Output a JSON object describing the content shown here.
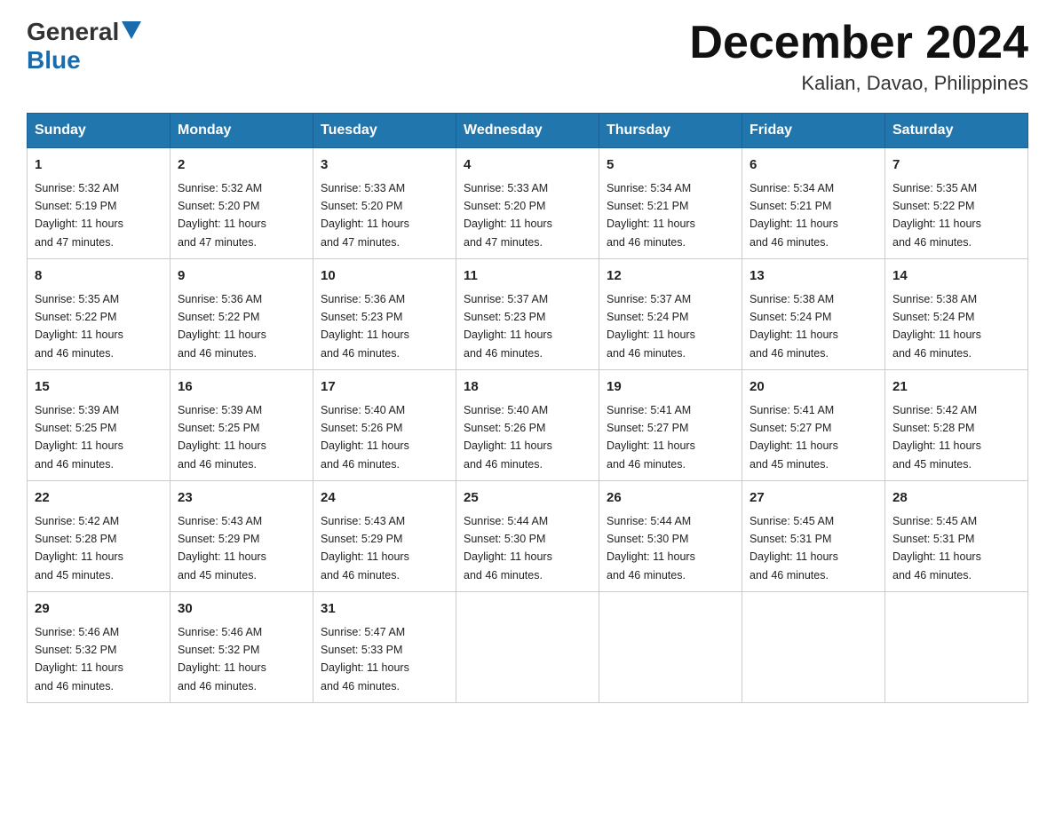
{
  "header": {
    "logo": {
      "general": "General",
      "blue": "Blue"
    },
    "month_year": "December 2024",
    "location": "Kalian, Davao, Philippines"
  },
  "weekdays": [
    "Sunday",
    "Monday",
    "Tuesday",
    "Wednesday",
    "Thursday",
    "Friday",
    "Saturday"
  ],
  "weeks": [
    [
      {
        "day": "1",
        "sunrise": "5:32 AM",
        "sunset": "5:19 PM",
        "daylight": "11 hours and 47 minutes."
      },
      {
        "day": "2",
        "sunrise": "5:32 AM",
        "sunset": "5:20 PM",
        "daylight": "11 hours and 47 minutes."
      },
      {
        "day": "3",
        "sunrise": "5:33 AM",
        "sunset": "5:20 PM",
        "daylight": "11 hours and 47 minutes."
      },
      {
        "day": "4",
        "sunrise": "5:33 AM",
        "sunset": "5:20 PM",
        "daylight": "11 hours and 47 minutes."
      },
      {
        "day": "5",
        "sunrise": "5:34 AM",
        "sunset": "5:21 PM",
        "daylight": "11 hours and 46 minutes."
      },
      {
        "day": "6",
        "sunrise": "5:34 AM",
        "sunset": "5:21 PM",
        "daylight": "11 hours and 46 minutes."
      },
      {
        "day": "7",
        "sunrise": "5:35 AM",
        "sunset": "5:22 PM",
        "daylight": "11 hours and 46 minutes."
      }
    ],
    [
      {
        "day": "8",
        "sunrise": "5:35 AM",
        "sunset": "5:22 PM",
        "daylight": "11 hours and 46 minutes."
      },
      {
        "day": "9",
        "sunrise": "5:36 AM",
        "sunset": "5:22 PM",
        "daylight": "11 hours and 46 minutes."
      },
      {
        "day": "10",
        "sunrise": "5:36 AM",
        "sunset": "5:23 PM",
        "daylight": "11 hours and 46 minutes."
      },
      {
        "day": "11",
        "sunrise": "5:37 AM",
        "sunset": "5:23 PM",
        "daylight": "11 hours and 46 minutes."
      },
      {
        "day": "12",
        "sunrise": "5:37 AM",
        "sunset": "5:24 PM",
        "daylight": "11 hours and 46 minutes."
      },
      {
        "day": "13",
        "sunrise": "5:38 AM",
        "sunset": "5:24 PM",
        "daylight": "11 hours and 46 minutes."
      },
      {
        "day": "14",
        "sunrise": "5:38 AM",
        "sunset": "5:24 PM",
        "daylight": "11 hours and 46 minutes."
      }
    ],
    [
      {
        "day": "15",
        "sunrise": "5:39 AM",
        "sunset": "5:25 PM",
        "daylight": "11 hours and 46 minutes."
      },
      {
        "day": "16",
        "sunrise": "5:39 AM",
        "sunset": "5:25 PM",
        "daylight": "11 hours and 46 minutes."
      },
      {
        "day": "17",
        "sunrise": "5:40 AM",
        "sunset": "5:26 PM",
        "daylight": "11 hours and 46 minutes."
      },
      {
        "day": "18",
        "sunrise": "5:40 AM",
        "sunset": "5:26 PM",
        "daylight": "11 hours and 46 minutes."
      },
      {
        "day": "19",
        "sunrise": "5:41 AM",
        "sunset": "5:27 PM",
        "daylight": "11 hours and 46 minutes."
      },
      {
        "day": "20",
        "sunrise": "5:41 AM",
        "sunset": "5:27 PM",
        "daylight": "11 hours and 45 minutes."
      },
      {
        "day": "21",
        "sunrise": "5:42 AM",
        "sunset": "5:28 PM",
        "daylight": "11 hours and 45 minutes."
      }
    ],
    [
      {
        "day": "22",
        "sunrise": "5:42 AM",
        "sunset": "5:28 PM",
        "daylight": "11 hours and 45 minutes."
      },
      {
        "day": "23",
        "sunrise": "5:43 AM",
        "sunset": "5:29 PM",
        "daylight": "11 hours and 45 minutes."
      },
      {
        "day": "24",
        "sunrise": "5:43 AM",
        "sunset": "5:29 PM",
        "daylight": "11 hours and 46 minutes."
      },
      {
        "day": "25",
        "sunrise": "5:44 AM",
        "sunset": "5:30 PM",
        "daylight": "11 hours and 46 minutes."
      },
      {
        "day": "26",
        "sunrise": "5:44 AM",
        "sunset": "5:30 PM",
        "daylight": "11 hours and 46 minutes."
      },
      {
        "day": "27",
        "sunrise": "5:45 AM",
        "sunset": "5:31 PM",
        "daylight": "11 hours and 46 minutes."
      },
      {
        "day": "28",
        "sunrise": "5:45 AM",
        "sunset": "5:31 PM",
        "daylight": "11 hours and 46 minutes."
      }
    ],
    [
      {
        "day": "29",
        "sunrise": "5:46 AM",
        "sunset": "5:32 PM",
        "daylight": "11 hours and 46 minutes."
      },
      {
        "day": "30",
        "sunrise": "5:46 AM",
        "sunset": "5:32 PM",
        "daylight": "11 hours and 46 minutes."
      },
      {
        "day": "31",
        "sunrise": "5:47 AM",
        "sunset": "5:33 PM",
        "daylight": "11 hours and 46 minutes."
      },
      null,
      null,
      null,
      null
    ]
  ],
  "labels": {
    "sunrise": "Sunrise:",
    "sunset": "Sunset:",
    "daylight": "Daylight:"
  }
}
